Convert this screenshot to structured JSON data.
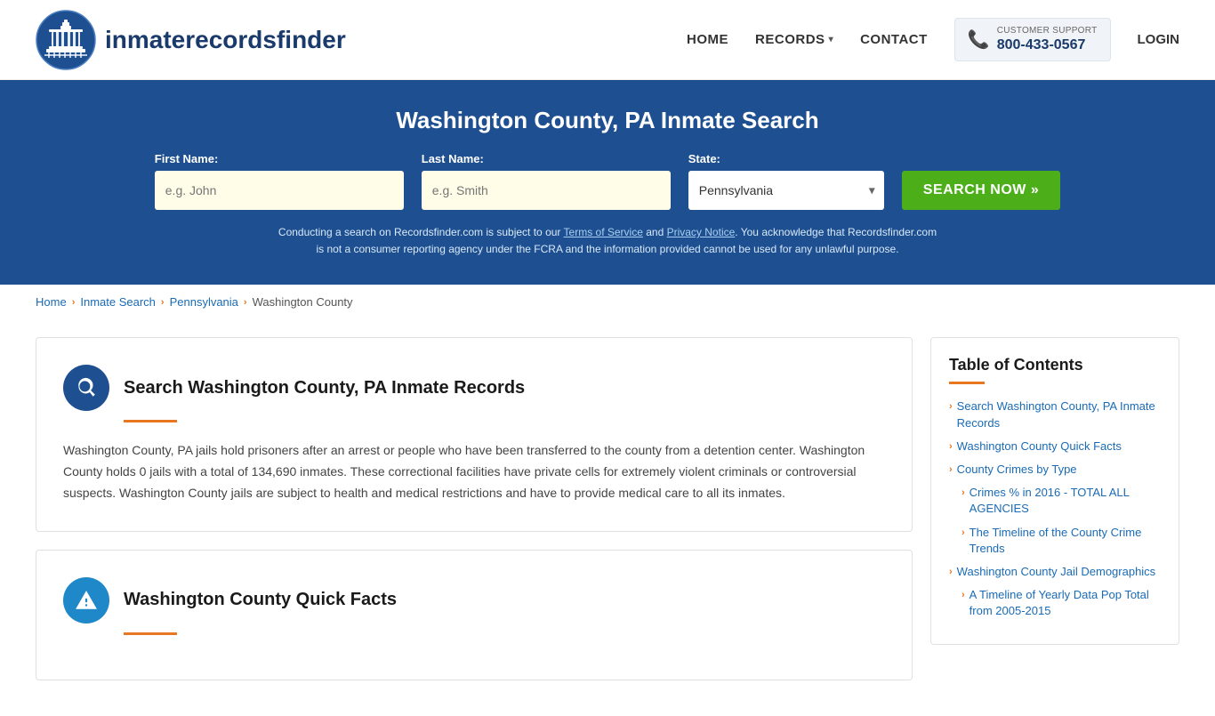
{
  "header": {
    "logo_text_normal": "inmaterecords",
    "logo_text_bold": "finder",
    "nav": {
      "home": "HOME",
      "records": "RECORDS",
      "contact": "CONTACT",
      "login": "LOGIN"
    },
    "support": {
      "label": "CUSTOMER SUPPORT",
      "phone": "800-433-0567"
    }
  },
  "hero": {
    "title": "Washington County, PA Inmate Search",
    "form": {
      "first_name_label": "First Name:",
      "first_name_placeholder": "e.g. John",
      "last_name_label": "Last Name:",
      "last_name_placeholder": "e.g. Smith",
      "state_label": "State:",
      "state_value": "Pennsylvania",
      "search_button": "SEARCH NOW »"
    },
    "disclaimer": "Conducting a search on Recordsfinder.com is subject to our Terms of Service and Privacy Notice. You acknowledge that Recordsfinder.com is not a consumer reporting agency under the FCRA and the information provided cannot be used for any unlawful purpose."
  },
  "breadcrumb": {
    "items": [
      "Home",
      "Inmate Search",
      "Pennsylvania",
      "Washington County"
    ]
  },
  "main": {
    "section1": {
      "title": "Search Washington County, PA Inmate Records",
      "body": "Washington County, PA jails hold prisoners after an arrest or people who have been transferred to the county from a detention center. Washington County holds 0 jails with a total of 134,690 inmates. These correctional facilities have private cells for extremely violent criminals or controversial suspects. Washington County jails are subject to health and medical restrictions and have to provide medical care to all its inmates."
    },
    "section2": {
      "title": "Washington County Quick Facts"
    }
  },
  "toc": {
    "title": "Table of Contents",
    "items": [
      {
        "label": "Search Washington County, PA Inmate Records",
        "sub": false
      },
      {
        "label": "Washington County Quick Facts",
        "sub": false
      },
      {
        "label": "County Crimes by Type",
        "sub": false
      },
      {
        "label": "Crimes % in 2016 - TOTAL ALL AGENCIES",
        "sub": true
      },
      {
        "label": "The Timeline of the County Crime Trends",
        "sub": true
      },
      {
        "label": "Washington County Jail Demographics",
        "sub": false
      },
      {
        "label": "A Timeline of Yearly Data Pop Total from 2005-2015",
        "sub": true
      }
    ]
  }
}
